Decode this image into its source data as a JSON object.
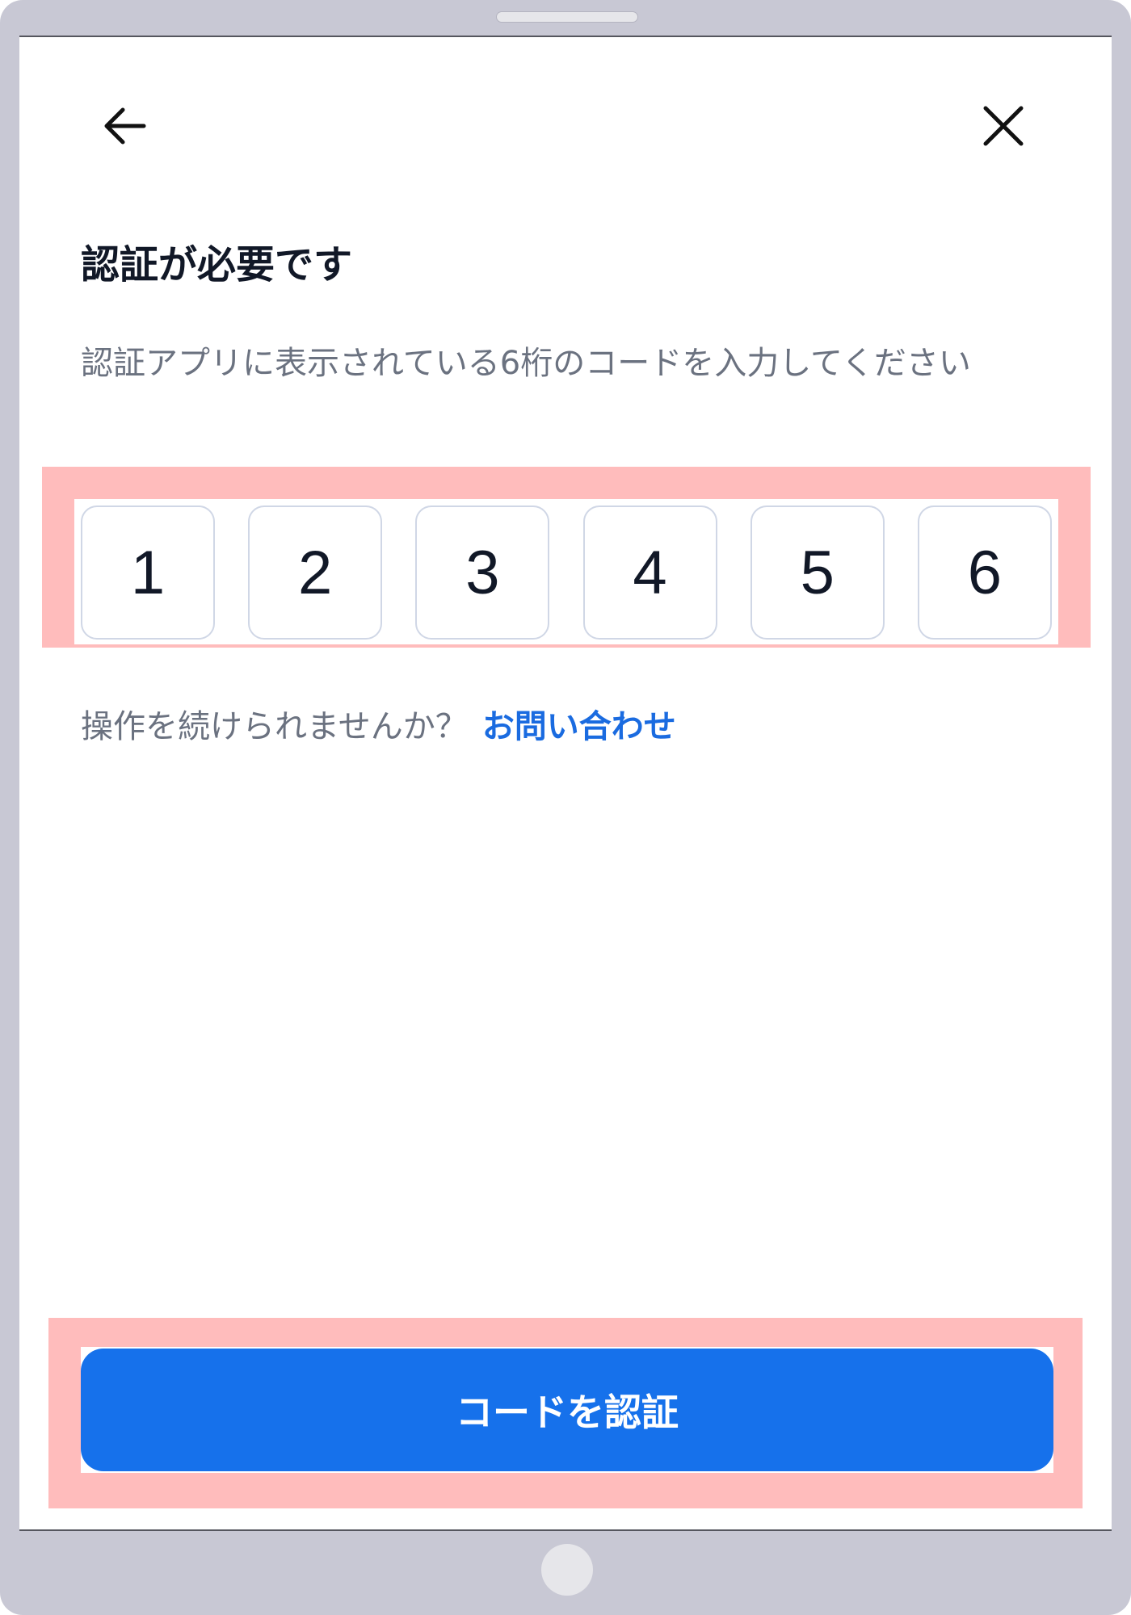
{
  "header": {
    "back_icon": "arrow-left-icon",
    "close_icon": "close-icon"
  },
  "content": {
    "title": "認証が必要です",
    "description": "認証アプリに表示されている6桁のコードを入力してください"
  },
  "otp": {
    "digits": [
      "1",
      "2",
      "3",
      "4",
      "5",
      "6"
    ]
  },
  "help": {
    "text": "操作を続けられませんか？",
    "link_label": "お問い合わせ"
  },
  "actions": {
    "verify_label": "コードを認証"
  },
  "colors": {
    "primary": "#1671eb",
    "link": "#1a6be0",
    "highlight": "#ffbcbc",
    "text_primary": "#111827",
    "text_secondary": "#6b7280"
  }
}
